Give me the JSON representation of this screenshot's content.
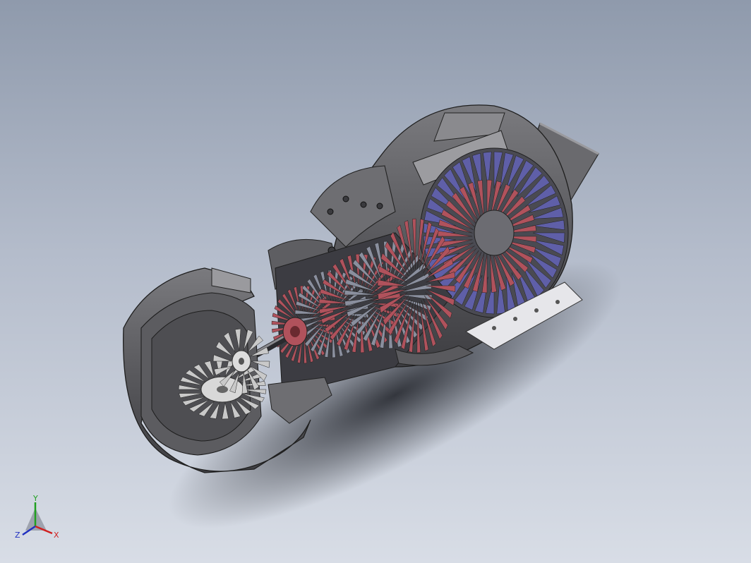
{
  "viewport": {
    "background_top": "#8f9aac",
    "background_bottom": "#d8dde6"
  },
  "model": {
    "housing_color": "#5b5b5e",
    "compressor_blade_color": "#b0525c",
    "stator_blade_color": "#8a8f9e",
    "turbine_blade_color": "#5f5fa8",
    "gear_color": "#c9c9c9"
  },
  "triad": {
    "x_label": "X",
    "y_label": "Y",
    "z_label": "Z",
    "x_color": "#d02020",
    "y_color": "#20a020",
    "z_color": "#2030c0"
  }
}
